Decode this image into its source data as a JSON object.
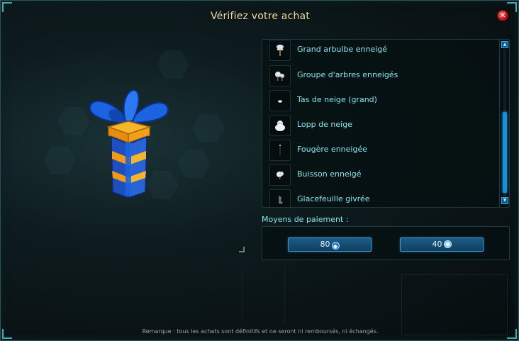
{
  "dialog": {
    "title": "Vérifiez votre achat",
    "close_icon": "close-icon"
  },
  "preview": {
    "icon": "gift-box-icon",
    "colors": {
      "box_blue": "#1f4fbf",
      "box_orange": "#f29a16",
      "ribbon": "#1b63e0"
    }
  },
  "items": [
    {
      "label": "Grand arbulbe enneigé",
      "icon": "snowy-tree-icon"
    },
    {
      "label": "Groupe d'arbres enneigés",
      "icon": "snowy-trees-group-icon"
    },
    {
      "label": "Tas de neige (grand)",
      "icon": "snow-pile-icon"
    },
    {
      "label": "Lopp de neige",
      "icon": "snow-creature-icon"
    },
    {
      "label": "Fougère enneigée",
      "icon": "snowy-fern-icon"
    },
    {
      "label": "Buisson enneigé",
      "icon": "snowy-bush-icon"
    },
    {
      "label": "Glacefeuille givrée",
      "icon": "frost-leaf-icon"
    }
  ],
  "payment": {
    "label": "Moyens de paiement :",
    "options": [
      {
        "amount": "80",
        "currency_icon": "ogrine-icon"
      },
      {
        "amount": "40",
        "currency_icon": "kama-icon"
      }
    ]
  },
  "footer": {
    "remark": "Remarque : tous les achats sont définitifs et ne seront ni remboursés, ni échangés."
  }
}
